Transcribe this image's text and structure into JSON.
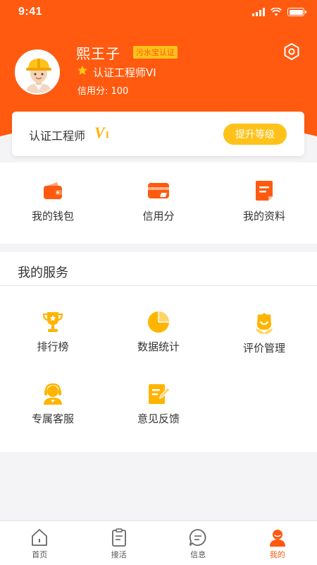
{
  "status_bar": {
    "time": "9:41"
  },
  "profile": {
    "name": "熙王子",
    "badge": "污水宝认证",
    "level": "认证工程师VI",
    "credit": "信用分: 100"
  },
  "level_card": {
    "title": "认证工程师",
    "level_letter": "V",
    "level_number": "1",
    "upgrade_button": "提升等级"
  },
  "quick_actions": [
    {
      "label": "我的钱包",
      "icon": "wallet-icon"
    },
    {
      "label": "信用分",
      "icon": "card-icon"
    },
    {
      "label": "我的资料",
      "icon": "document-icon"
    }
  ],
  "services": {
    "title": "我的服务",
    "items": [
      {
        "label": "排行榜",
        "icon": "trophy-icon"
      },
      {
        "label": "数据统计",
        "icon": "pie-chart-icon"
      },
      {
        "label": "评价管理",
        "icon": "flower-icon"
      },
      {
        "label": "专属客服",
        "icon": "headset-icon"
      },
      {
        "label": "意见反馈",
        "icon": "edit-icon"
      }
    ]
  },
  "tabbar": [
    {
      "label": "首页",
      "icon": "home-icon",
      "active": false
    },
    {
      "label": "接活",
      "icon": "clipboard-icon",
      "active": false
    },
    {
      "label": "信息",
      "icon": "chat-icon",
      "active": false
    },
    {
      "label": "我的",
      "icon": "user-icon",
      "active": true
    }
  ],
  "colors": {
    "brand": "#ff5a0f",
    "accent": "#ffc21a"
  }
}
